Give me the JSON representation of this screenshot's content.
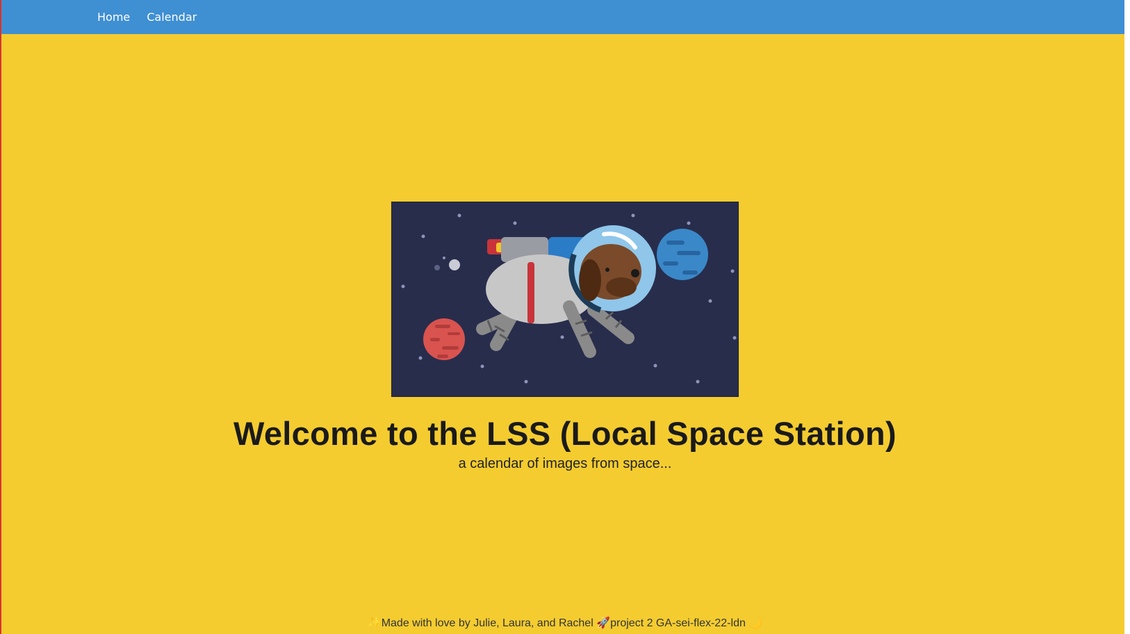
{
  "nav": {
    "items": [
      {
        "label": "Home"
      },
      {
        "label": "Calendar"
      }
    ]
  },
  "hero": {
    "image_icon": "astronaut-dog-illustration",
    "title": "Welcome to the LSS (Local Space Station)",
    "subtitle": "a calendar of images from space..."
  },
  "footer": {
    "text": "✨Made with love by Julie, Laura, and Rachel 🚀project 2 GA-sei-flex-22-ldn 🌙"
  },
  "colors": {
    "background": "#f4cc30",
    "navbar": "#3f8fd3",
    "image_background": "#282d4c"
  }
}
